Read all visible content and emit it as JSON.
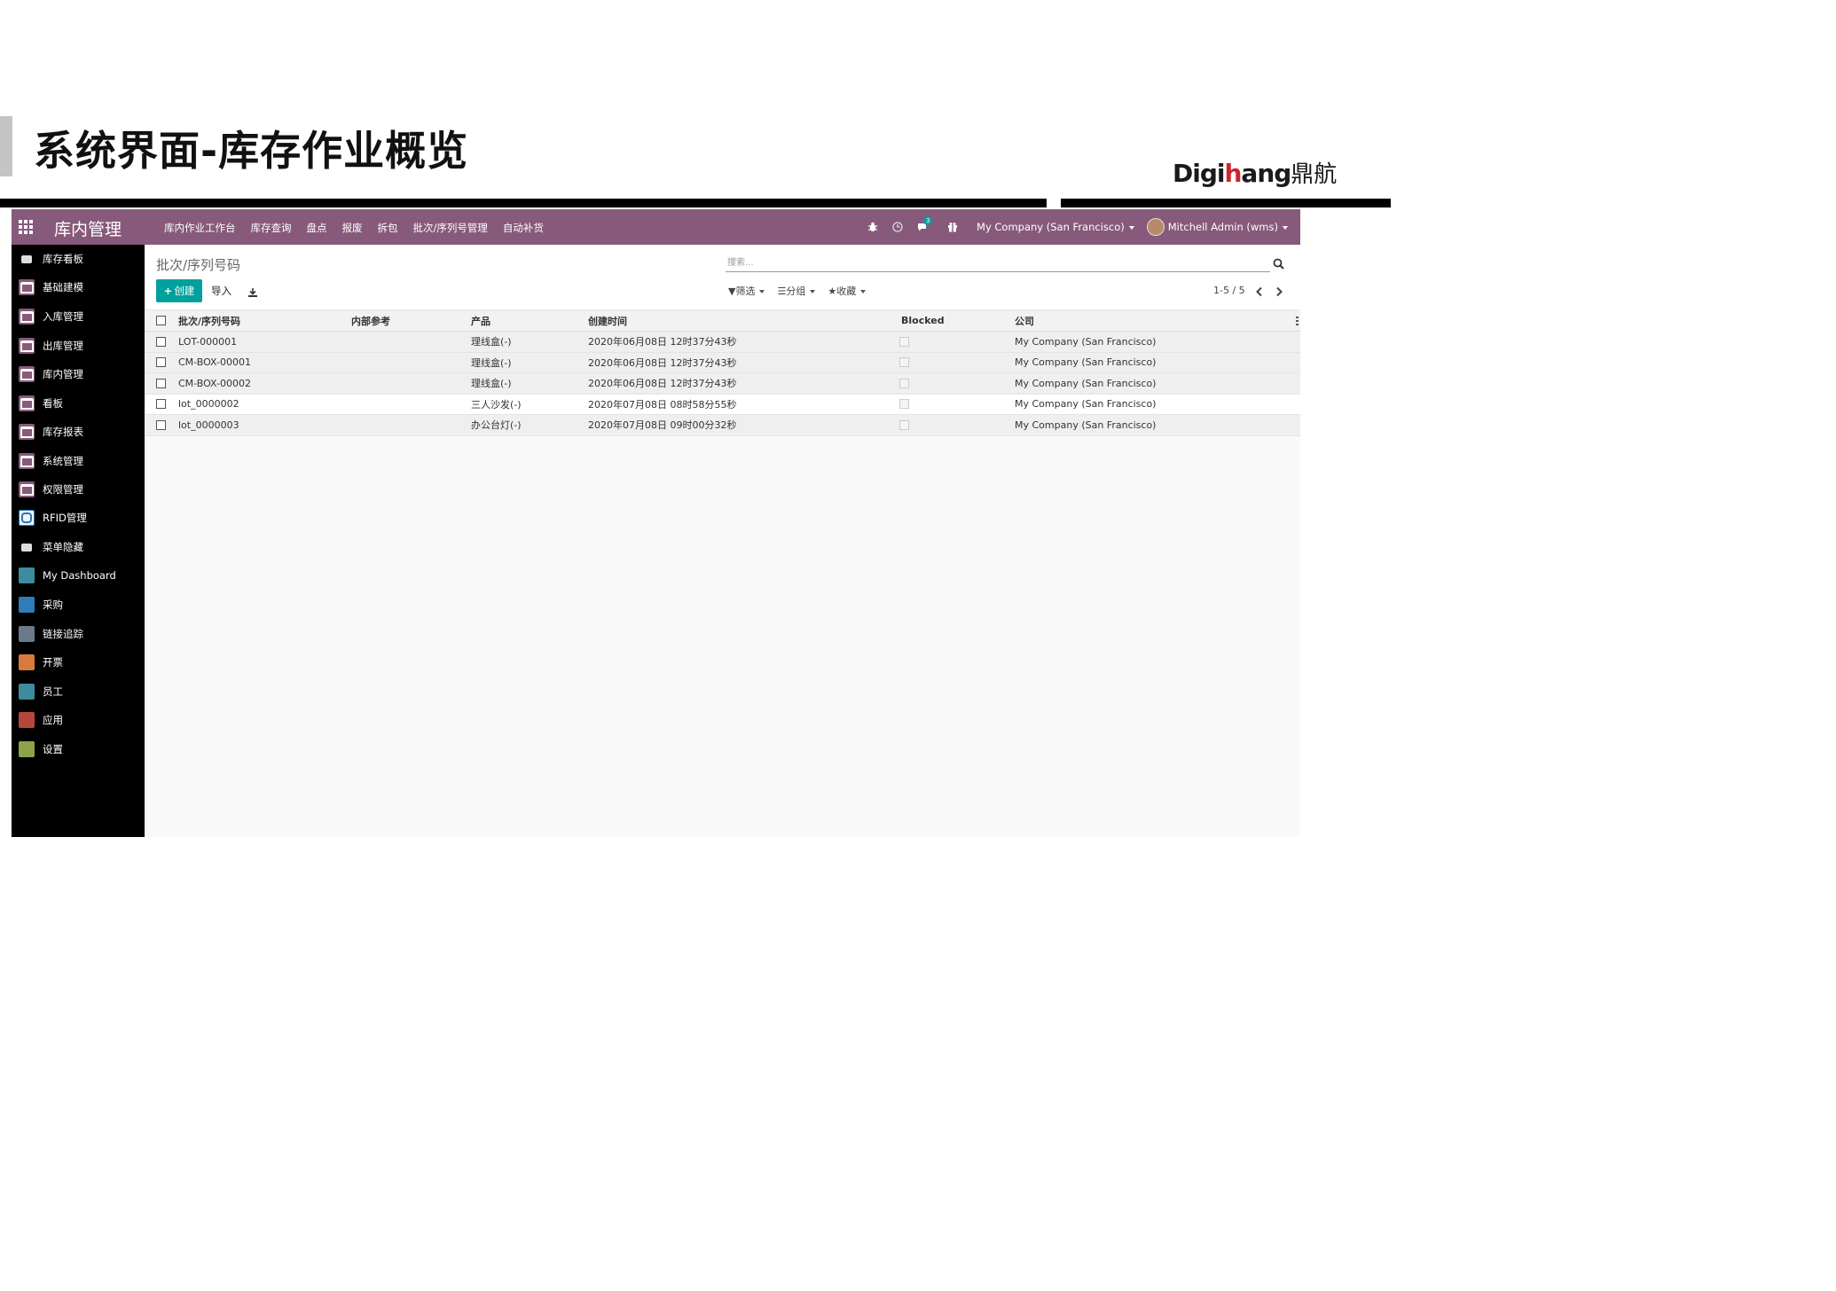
{
  "slide": {
    "title": "系统界面-库存作业概览",
    "brand_dig": "Digi",
    "brand_h": "h",
    "brand_ang": "ang",
    "brand_cn": "鼎航"
  },
  "topbar": {
    "app_name": "库内管理",
    "menu": [
      "库内作业工作台",
      "库存查询",
      "盘点",
      "报废",
      "拆包",
      "批次/序列号管理",
      "自动补货"
    ],
    "message_count": "3",
    "company": "My Company (San Francisco)",
    "user": "Mitchell Admin (wms)",
    "brand_color": "#875a7b"
  },
  "sidebar": {
    "items": [
      {
        "label": "库存看板",
        "icon": "camera-icon"
      },
      {
        "label": "基础建模",
        "icon": "warehouse-icon"
      },
      {
        "label": "入库管理",
        "icon": "warehouse-icon"
      },
      {
        "label": "出库管理",
        "icon": "warehouse-icon"
      },
      {
        "label": "库内管理",
        "icon": "warehouse-icon"
      },
      {
        "label": "看板",
        "icon": "warehouse-icon"
      },
      {
        "label": "库存报表",
        "icon": "warehouse-icon"
      },
      {
        "label": "系统管理",
        "icon": "warehouse-icon"
      },
      {
        "label": "权限管理",
        "icon": "warehouse-icon"
      },
      {
        "label": "RFID管理",
        "icon": "rfid-icon"
      },
      {
        "label": "菜单隐藏",
        "icon": "camera-icon"
      },
      {
        "label": "My Dashboard",
        "icon": "dashboard-icon"
      },
      {
        "label": "采购",
        "icon": "purchase-icon"
      },
      {
        "label": "链接追踪",
        "icon": "link-icon"
      },
      {
        "label": "开票",
        "icon": "invoice-icon"
      },
      {
        "label": "员工",
        "icon": "employees-icon"
      },
      {
        "label": "应用",
        "icon": "apps-icon"
      },
      {
        "label": "设置",
        "icon": "settings-icon"
      }
    ]
  },
  "control_panel": {
    "breadcrumb": "批次/序列号码",
    "search_placeholder": "搜索...",
    "create_label": "创建",
    "import_label": "导入",
    "filter_label": "筛选",
    "group_label": "分组",
    "favorites_label": "收藏",
    "pager": "1-5 / 5",
    "accent_color": "#00a09d"
  },
  "table": {
    "columns": [
      "批次/序列号码",
      "内部参考",
      "产品",
      "创建时间",
      "Blocked",
      "公司"
    ],
    "rows": [
      {
        "lot": "LOT-000001",
        "ref": "",
        "product": "理线盒(-)",
        "created": "2020年06月08日 12时37分43秒",
        "company": "My Company (San Francisco)"
      },
      {
        "lot": "CM-BOX-00001",
        "ref": "",
        "product": "理线盒(-)",
        "created": "2020年06月08日 12时37分43秒",
        "company": "My Company (San Francisco)"
      },
      {
        "lot": "CM-BOX-00002",
        "ref": "",
        "product": "理线盒(-)",
        "created": "2020年06月08日 12时37分43秒",
        "company": "My Company (San Francisco)"
      },
      {
        "lot": "lot_0000002",
        "ref": "",
        "product": "三人沙发(-)",
        "created": "2020年07月08日 08时58分55秒",
        "company": "My Company (San Francisco)"
      },
      {
        "lot": "lot_0000003",
        "ref": "",
        "product": "办公台灯(-)",
        "created": "2020年07月08日 09时00分32秒",
        "company": "My Company (San Francisco)"
      }
    ]
  }
}
